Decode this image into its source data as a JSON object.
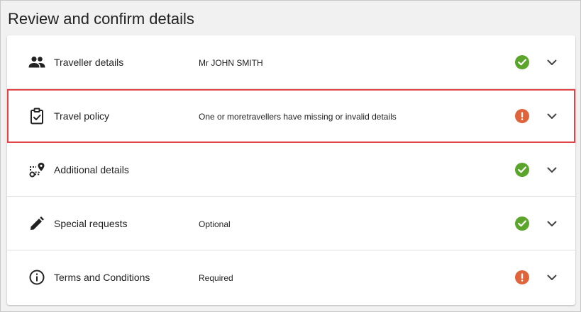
{
  "page": {
    "title": "Review and confirm details"
  },
  "colors": {
    "ok": "#5aa52a",
    "warning": "#e0643b",
    "highlight_border": "#e24545"
  },
  "rows": [
    {
      "icon": "people-icon",
      "label": "Traveller details",
      "value": "Mr JOHN SMITH",
      "status": "ok",
      "status_icon": "check-circle-icon"
    },
    {
      "icon": "clipboard-check-icon",
      "label": "Travel policy",
      "value": "One or moretravellers have missing or invalid details",
      "status": "warning",
      "status_icon": "exclamation-circle-icon",
      "highlighted": true
    },
    {
      "icon": "route-pin-icon",
      "label": "Additional details",
      "value": "",
      "status": "ok",
      "status_icon": "check-circle-icon"
    },
    {
      "icon": "pencil-icon",
      "label": "Special requests",
      "value": "Optional",
      "status": "ok",
      "status_icon": "check-circle-icon"
    },
    {
      "icon": "info-icon",
      "label": "Terms and Conditions",
      "value": "Required",
      "status": "warning",
      "status_icon": "exclamation-circle-icon"
    }
  ],
  "expand_icon": "chevron-down-icon"
}
